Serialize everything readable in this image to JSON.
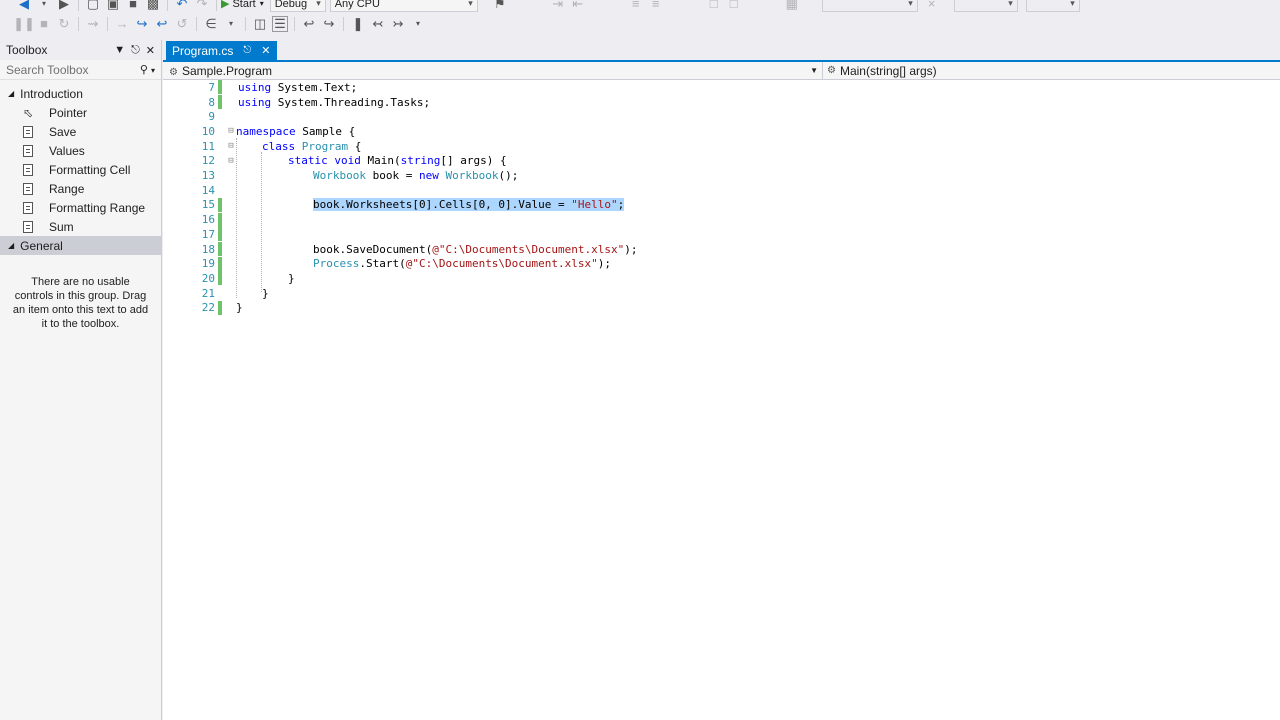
{
  "toolbar": {
    "start_label": "Start",
    "config_value": "Debug",
    "platform_value": "Any CPU"
  },
  "toolbox": {
    "title": "Toolbox",
    "search_placeholder": "Search Toolbox",
    "groups": [
      {
        "label": "Introduction",
        "items": [
          "Pointer",
          "Save",
          "Values",
          "Formatting Cell",
          "Range",
          "Formatting Range",
          "Sum"
        ]
      },
      {
        "label": "General",
        "empty_message": "There are no usable controls in this group. Drag an item onto this text to add it to the toolbox."
      }
    ]
  },
  "tabs": [
    {
      "label": "Program.cs",
      "active": true
    }
  ],
  "navbar": {
    "scope": "Sample.Program",
    "member": "Main(string[] args)"
  },
  "editor": {
    "lines": [
      {
        "num": "7",
        "text": "using System.Text;"
      },
      {
        "num": "8",
        "text": "using System.Threading.Tasks;"
      },
      {
        "num": "9",
        "text": ""
      },
      {
        "num": "10",
        "text": "namespace Sample {"
      },
      {
        "num": "11",
        "text": "class Program {"
      },
      {
        "num": "12",
        "text": "static void Main(string[] args) {"
      },
      {
        "num": "13",
        "text": "Workbook book = new Workbook();"
      },
      {
        "num": "14",
        "text": ""
      },
      {
        "num": "15",
        "text": "book.Worksheets[0].Cells[0, 0].Value = \"Hello\";"
      },
      {
        "num": "16",
        "text": ""
      },
      {
        "num": "17",
        "text": ""
      },
      {
        "num": "18",
        "text": "book.SaveDocument(@\"C:\\Documents\\Document.xlsx\");"
      },
      {
        "num": "19",
        "text": "Process.Start(@\"C:\\Documents\\Document.xlsx\");"
      },
      {
        "num": "20",
        "text": "}"
      },
      {
        "num": "21",
        "text": "}"
      },
      {
        "num": "22",
        "text": "}"
      }
    ]
  },
  "colors": {
    "accent": "#007acc",
    "keyword": "#0000ff",
    "type": "#2b91af",
    "string": "#a31515",
    "selection": "#add6ff",
    "change_marker": "#6fc36a"
  }
}
